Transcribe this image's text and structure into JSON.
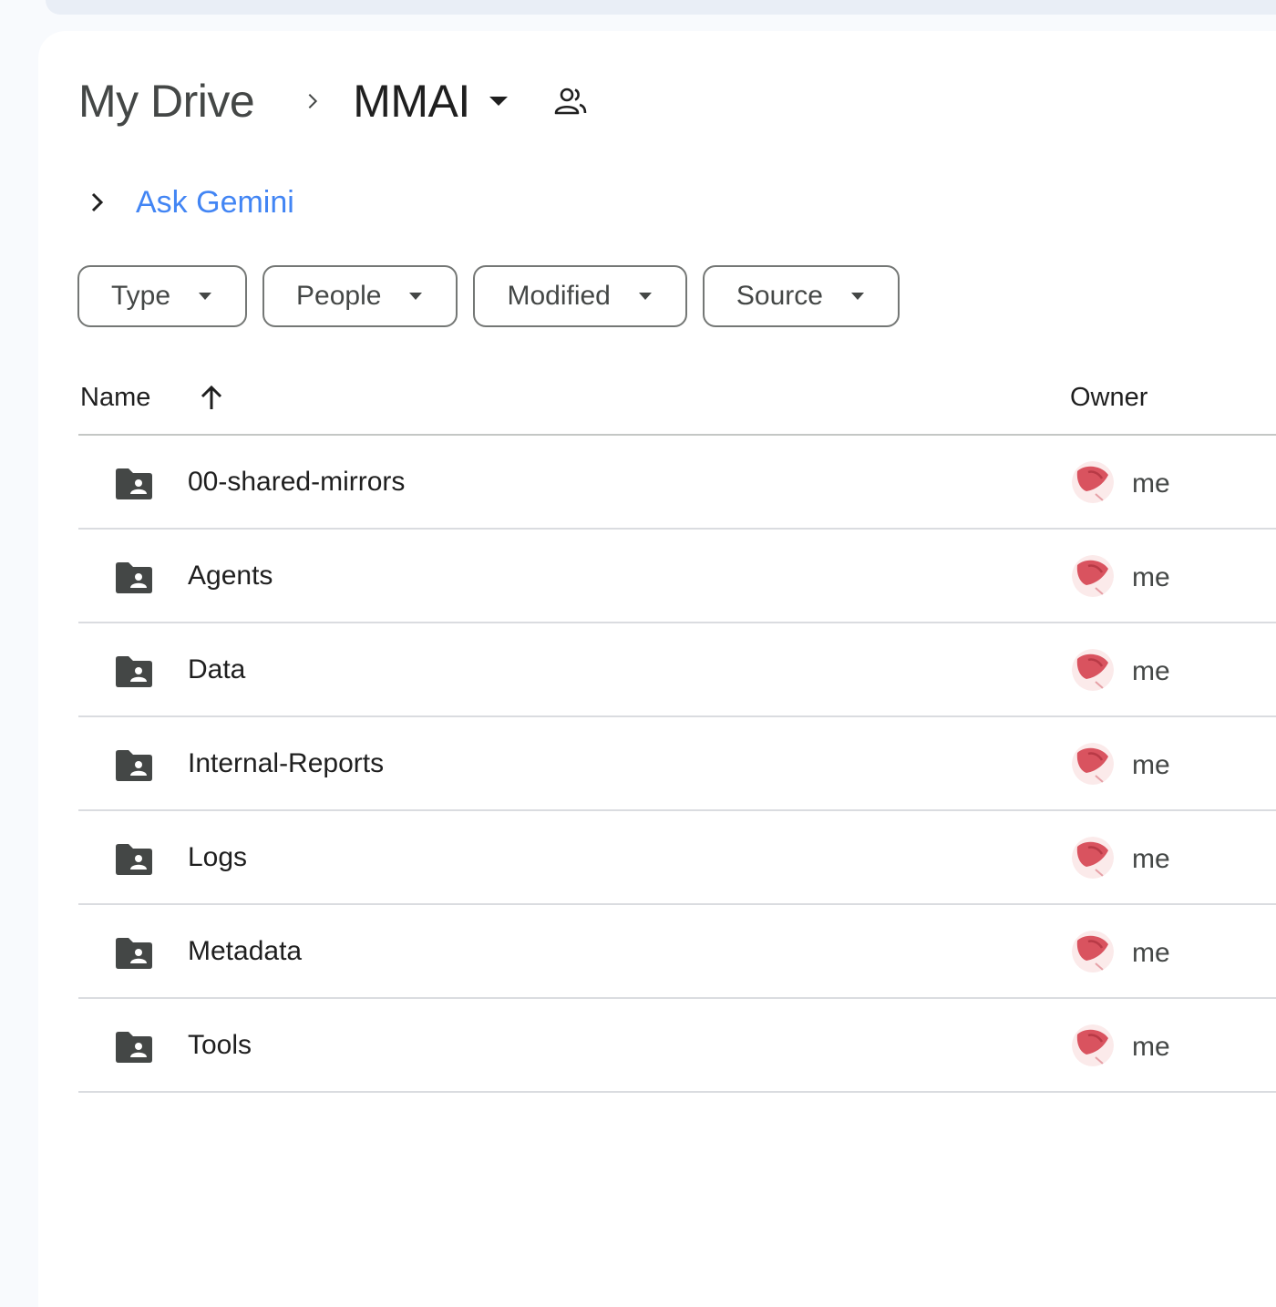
{
  "breadcrumb": {
    "root": "My Drive",
    "current": "MMAI"
  },
  "gemini": {
    "label": "Ask Gemini"
  },
  "filters": [
    {
      "label": "Type"
    },
    {
      "label": "People"
    },
    {
      "label": "Modified"
    },
    {
      "label": "Source"
    }
  ],
  "table": {
    "columns": {
      "name": "Name",
      "owner": "Owner"
    },
    "sort": {
      "column": "Name",
      "direction": "ascending"
    },
    "rows": [
      {
        "name": "00-shared-mirrors",
        "owner": "me"
      },
      {
        "name": "Agents",
        "owner": "me"
      },
      {
        "name": "Data",
        "owner": "me"
      },
      {
        "name": "Internal-Reports",
        "owner": "me"
      },
      {
        "name": "Logs",
        "owner": "me"
      },
      {
        "name": "Metadata",
        "owner": "me"
      },
      {
        "name": "Tools",
        "owner": "me"
      }
    ]
  },
  "icons": {
    "breadcrumb_separator": "chevron-right-icon",
    "folder_menu": "caret-down-icon",
    "shared": "people-icon",
    "row_folder": "shared-folder-icon",
    "owner_avatar": "avatar-icon",
    "sort": "arrow-up-icon"
  },
  "colors": {
    "accent": "#4285f4",
    "background": "#f8fafd",
    "surface": "#ffffff",
    "folder_icon": "#444746",
    "avatar": "#d9535f"
  }
}
